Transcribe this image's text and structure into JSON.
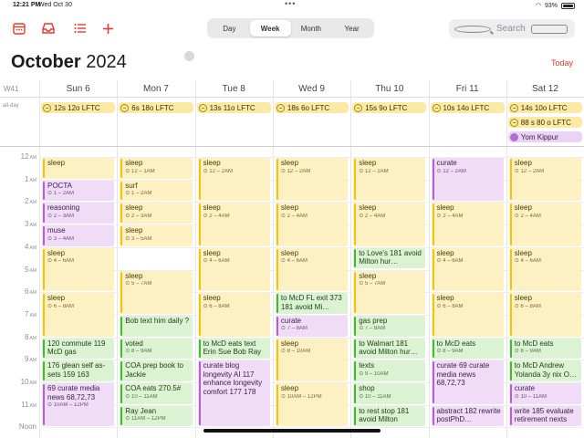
{
  "status_bar": {
    "time": "12:21 PM",
    "date": "Wed Oct 30",
    "battery": "93%",
    "dots": "•••"
  },
  "toolbar": {
    "view_tabs": [
      "Day",
      "Week",
      "Month",
      "Year"
    ],
    "active_tab": "Week",
    "search_placeholder": "Search"
  },
  "header": {
    "month": "October",
    "year": "2024",
    "today_label": "Today",
    "week_label": "W41"
  },
  "days": [
    "Sun 6",
    "Mon 7",
    "Tue 8",
    "Wed 9",
    "Thu 10",
    "Fri 11",
    "Sat 12"
  ],
  "allday_label": "all-day",
  "allday_events": [
    {
      "day": 0,
      "row": 0,
      "title": "12s 12o LFTC",
      "color": "yellow"
    },
    {
      "day": 1,
      "row": 0,
      "title": "6s 18o LFTC",
      "color": "yellow"
    },
    {
      "day": 2,
      "row": 0,
      "title": "13s 11o LFTC",
      "color": "yellow"
    },
    {
      "day": 3,
      "row": 0,
      "title": "18s 6o LFTC",
      "color": "yellow"
    },
    {
      "day": 4,
      "row": 0,
      "title": "15s 9o LFTC",
      "color": "yellow"
    },
    {
      "day": 5,
      "row": 0,
      "title": "10s 14o LFTC",
      "color": "yellow"
    },
    {
      "day": 6,
      "row": 0,
      "title": "14s 10o LFTC",
      "color": "yellow"
    },
    {
      "day": 6,
      "row": 1,
      "title": "88 s 80 o LFTC",
      "color": "yellow"
    },
    {
      "day": 6,
      "row": 2,
      "title": "Yom Kippur",
      "color": "purple"
    }
  ],
  "hours": [
    {
      "n": "12",
      "ap": "AM"
    },
    {
      "n": "1",
      "ap": "AM"
    },
    {
      "n": "2",
      "ap": "AM"
    },
    {
      "n": "3",
      "ap": "AM"
    },
    {
      "n": "4",
      "ap": "AM"
    },
    {
      "n": "5",
      "ap": "AM"
    },
    {
      "n": "6",
      "ap": "AM"
    },
    {
      "n": "7",
      "ap": "AM"
    },
    {
      "n": "8",
      "ap": "AM"
    },
    {
      "n": "9",
      "ap": "AM"
    },
    {
      "n": "10",
      "ap": "AM"
    },
    {
      "n": "11",
      "ap": "AM"
    },
    {
      "n": "Noon",
      "ap": ""
    }
  ],
  "events": [
    {
      "day": 0,
      "start": 0,
      "end": 1,
      "color": "yellow",
      "title": "sleep",
      "time": ""
    },
    {
      "day": 0,
      "start": 1,
      "end": 2,
      "color": "purple",
      "title": "POCTA",
      "time": "1 – 2AM"
    },
    {
      "day": 0,
      "start": 2,
      "end": 3,
      "color": "purple",
      "title": "reasoning",
      "time": "2 – 3AM"
    },
    {
      "day": 0,
      "start": 3,
      "end": 4,
      "color": "purple",
      "title": "muse",
      "time": "3 – 4AM"
    },
    {
      "day": 0,
      "start": 4,
      "end": 6,
      "color": "yellow",
      "title": "sleep",
      "time": "4 – 6AM"
    },
    {
      "day": 0,
      "start": 6,
      "end": 8,
      "color": "yellow",
      "title": "sleep",
      "time": "6 – 8AM"
    },
    {
      "day": 0,
      "start": 8,
      "end": 9,
      "color": "green",
      "title": "120 commute 119 McD gas",
      "time": ""
    },
    {
      "day": 0,
      "start": 9,
      "end": 10,
      "color": "green",
      "title": "176 glean self as­sets 159 163",
      "time": ""
    },
    {
      "day": 0,
      "start": 10,
      "end": 12,
      "color": "purple",
      "title": "69 curate media news 68,72,73",
      "time": "10AM – 12PM"
    },
    {
      "day": 1,
      "start": 0,
      "end": 1,
      "color": "yellow",
      "title": "sleep",
      "time": "12 – 1AM"
    },
    {
      "day": 1,
      "start": 1,
      "end": 2,
      "color": "yellow",
      "title": "surf",
      "time": "1 – 2AM"
    },
    {
      "day": 1,
      "start": 2,
      "end": 3,
      "color": "yellow",
      "title": "sleep",
      "time": "2 – 3AM"
    },
    {
      "day": 1,
      "start": 3,
      "end": 4,
      "color": "yellow",
      "title": "sleep",
      "time": "3 – 5AM"
    },
    {
      "day": 1,
      "start": 5,
      "end": 7,
      "color": "yellow",
      "title": "sleep",
      "time": "5 – 7AM"
    },
    {
      "day": 1,
      "start": 7,
      "end": 8,
      "color": "green",
      "title": "Bob text him daily ?",
      "time": ""
    },
    {
      "day": 1,
      "start": 8,
      "end": 9,
      "color": "green",
      "title": "voted",
      "time": "8 – 9AM"
    },
    {
      "day": 1,
      "start": 9,
      "end": 10,
      "color": "green",
      "title": "COA prep book to Jackie",
      "time": ""
    },
    {
      "day": 1,
      "start": 10,
      "end": 11,
      "color": "green",
      "title": "COA eats 270.5#",
      "time": "10 – 11AM"
    },
    {
      "day": 1,
      "start": 11,
      "end": 12,
      "color": "green",
      "title": "Ray Jean",
      "time": "11AM – 12PM"
    },
    {
      "day": 2,
      "start": 0,
      "end": 2,
      "color": "yellow",
      "title": "sleep",
      "time": "12 – 2AM"
    },
    {
      "day": 2,
      "start": 2,
      "end": 4,
      "color": "yellow",
      "title": "sleep",
      "time": "2 – 4AM"
    },
    {
      "day": 2,
      "start": 4,
      "end": 6,
      "color": "yellow",
      "title": "sleep",
      "time": "4 – 6AM"
    },
    {
      "day": 2,
      "start": 6,
      "end": 8,
      "color": "yellow",
      "title": "sleep",
      "time": "6 – 8AM"
    },
    {
      "day": 2,
      "start": 8,
      "end": 9,
      "color": "green",
      "title": "to McD eats text Erin Sue Bob Ray",
      "time": ""
    },
    {
      "day": 2,
      "start": 9,
      "end": 12,
      "color": "purple",
      "title": "curate blog longevity AI 117 enhance longevity comfort 177 178",
      "time": ""
    },
    {
      "day": 3,
      "start": 0,
      "end": 2,
      "color": "yellow",
      "title": "sleep",
      "time": "12 – 2AM"
    },
    {
      "day": 3,
      "start": 2,
      "end": 4,
      "color": "yellow",
      "title": "sleep",
      "time": "2 – 4AM"
    },
    {
      "day": 3,
      "start": 4,
      "end": 6,
      "color": "yellow",
      "title": "sleep",
      "time": "4 – 6AM"
    },
    {
      "day": 3,
      "start": 6,
      "end": 7,
      "color": "green",
      "title": "to McD FL exit 373 181 avoid Mi…",
      "time": ""
    },
    {
      "day": 3,
      "start": 7,
      "end": 8,
      "color": "purple",
      "title": "curate",
      "time": "7 – 8AM"
    },
    {
      "day": 3,
      "start": 8,
      "end": 10,
      "color": "yellow",
      "title": "sleep",
      "time": "8 – 10AM"
    },
    {
      "day": 3,
      "start": 10,
      "end": 12,
      "color": "yellow",
      "title": "sleep",
      "time": "10AM – 12PM"
    },
    {
      "day": 4,
      "start": 0,
      "end": 2,
      "color": "yellow",
      "title": "sleep",
      "time": "12 – 2AM"
    },
    {
      "day": 4,
      "start": 2,
      "end": 4,
      "color": "yellow",
      "title": "sleep",
      "time": "2 – 4AM"
    },
    {
      "day": 4,
      "start": 4,
      "end": 5,
      "color": "green",
      "title": "to Love's 181 avoid Milton hur…",
      "time": ""
    },
    {
      "day": 4,
      "start": 5,
      "end": 7,
      "color": "yellow",
      "title": "sleep",
      "time": "5 – 7AM"
    },
    {
      "day": 4,
      "start": 7,
      "end": 8,
      "color": "green",
      "title": "gas prep",
      "time": "7 – 8AM"
    },
    {
      "day": 4,
      "start": 8,
      "end": 9,
      "color": "green",
      "title": "to Walmart 181 avoid Milton hur…",
      "time": ""
    },
    {
      "day": 4,
      "start": 9,
      "end": 10,
      "color": "green",
      "title": "texts",
      "time": "9 – 10AM"
    },
    {
      "day": 4,
      "start": 10,
      "end": 11,
      "color": "green",
      "title": "shop",
      "time": "10 – 11AM"
    },
    {
      "day": 4,
      "start": 11,
      "end": 12,
      "color": "green",
      "title": "to rest stop 181 avoid Milton",
      "time": ""
    },
    {
      "day": 5,
      "start": 0,
      "end": 2,
      "color": "purple",
      "title": "curate",
      "time": "12 – 2AM"
    },
    {
      "day": 5,
      "start": 2,
      "end": 4,
      "color": "yellow",
      "title": "sleep",
      "time": "2 – 4AM"
    },
    {
      "day": 5,
      "start": 4,
      "end": 6,
      "color": "yellow",
      "title": "sleep",
      "time": "4 – 6AM"
    },
    {
      "day": 5,
      "start": 6,
      "end": 8,
      "color": "yellow",
      "title": "sleep",
      "time": "6 – 8AM"
    },
    {
      "day": 5,
      "start": 8,
      "end": 9,
      "color": "green",
      "title": "to McD eats",
      "time": "8 – 9AM"
    },
    {
      "day": 5,
      "start": 9,
      "end": 11,
      "color": "purple",
      "title": "curate 69 curate media news 68,72,73",
      "time": ""
    },
    {
      "day": 5,
      "start": 11,
      "end": 12,
      "color": "purple",
      "title": "abstract 182 rewrite postPhD…",
      "time": ""
    },
    {
      "day": 6,
      "start": 0,
      "end": 2,
      "color": "yellow",
      "title": "sleep",
      "time": "12 – 2AM"
    },
    {
      "day": 6,
      "start": 2,
      "end": 4,
      "color": "yellow",
      "title": "sleep",
      "time": "2 – 4AM"
    },
    {
      "day": 6,
      "start": 4,
      "end": 6,
      "color": "yellow",
      "title": "sleep",
      "time": "4 – 6AM"
    },
    {
      "day": 6,
      "start": 6,
      "end": 8,
      "color": "yellow",
      "title": "sleep",
      "time": "6 – 8AM"
    },
    {
      "day": 6,
      "start": 8,
      "end": 9,
      "color": "green",
      "title": "to McD eats",
      "time": "8 – 9AM"
    },
    {
      "day": 6,
      "start": 9,
      "end": 10,
      "color": "green",
      "title": "to McD Andrew Yolanda 3y nix O…",
      "time": ""
    },
    {
      "day": 6,
      "start": 10,
      "end": 11,
      "color": "purple",
      "title": "curate",
      "time": "10 – 11AM"
    },
    {
      "day": 6,
      "start": 11,
      "end": 12,
      "color": "purple",
      "title": "write 185 evaluate retirement nexts",
      "time": ""
    }
  ]
}
